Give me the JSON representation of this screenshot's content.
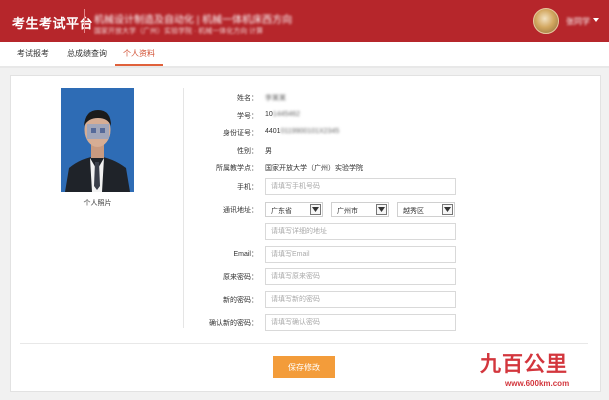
{
  "header": {
    "title": "考生考试平台",
    "blurred_line1": "机械设计制造及自动化 | 机械一体机床西方向",
    "blurred_line2": "国家开放大学（广州）实验学院 · 机械一体化方向 计算",
    "user_name": "张同学",
    "colors": {
      "primary": "#b6262b",
      "accent": "#e0613b",
      "button": "#f39c3a"
    }
  },
  "tabs": [
    {
      "label": "考试报考",
      "active": false
    },
    {
      "label": "总成绩查询",
      "active": false
    },
    {
      "label": "个人资料",
      "active": true
    }
  ],
  "profile": {
    "photo_label": "个人照片",
    "name_label": "姓名：",
    "name_value": "李某某",
    "student_id_label": "学号：",
    "student_id_value": "10",
    "student_id_blur": "1445462",
    "id_card_label": "身份证号：",
    "id_card_value": "4401",
    "id_card_blur": "0119900101X2345",
    "gender_label": "性别：",
    "gender_value": "男",
    "school_label": "所属教学点：",
    "school_value": "国家开放大学（广州）实验学院",
    "phone_label": "手机：",
    "phone_placeholder": "请填写手机号码",
    "address_label": "通讯地址：",
    "province": "广东省",
    "city": "广州市",
    "district": "越秀区",
    "address_placeholder": "请填写详细的地址",
    "email_label": "Email：",
    "email_placeholder": "请填写Email",
    "old_pwd_label": "原来密码：",
    "old_pwd_placeholder": "请填写原来密码",
    "new_pwd_label": "新的密码：",
    "new_pwd_placeholder": "请填写新的密码",
    "confirm_pwd_label": "确认新的密码：",
    "confirm_pwd_placeholder": "请填写确认密码",
    "save_label": "保存修改"
  },
  "watermark": {
    "logo": "九百公里",
    "url": "www.600km.com"
  },
  "icons": {
    "avatar": "user-avatar-icon",
    "dropdown": "chevron-down-icon"
  }
}
